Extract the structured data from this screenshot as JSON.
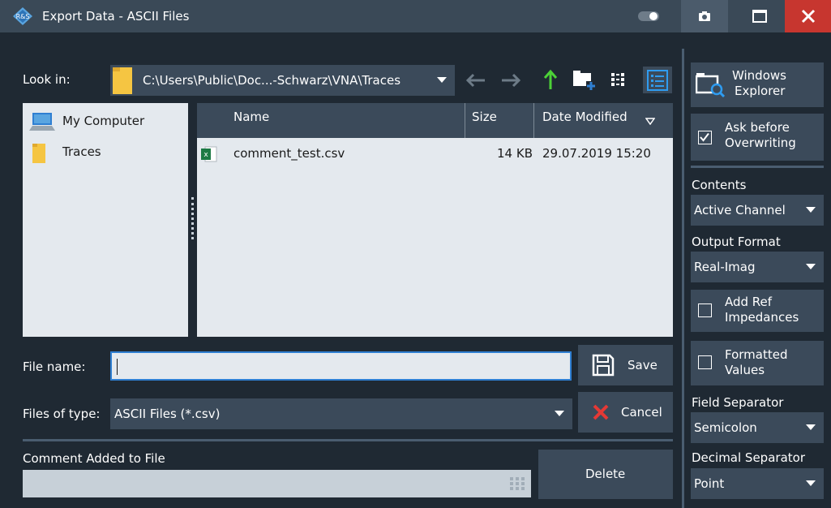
{
  "window": {
    "title": "Export Data - ASCII Files"
  },
  "look_in": {
    "label": "Look in:",
    "path": "C:\\Users\\Public\\Doc...-Schwarz\\VNA\\Traces"
  },
  "toolbar_icons": [
    "back-icon",
    "forward-icon",
    "up-icon",
    "new-folder-icon",
    "list-view-icon",
    "detail-view-icon"
  ],
  "tree": {
    "items": [
      {
        "label": "My Computer",
        "icon": "computer-icon"
      },
      {
        "label": "Traces",
        "icon": "folder-icon"
      }
    ]
  },
  "file_list": {
    "columns": {
      "name": "Name",
      "size": "Size",
      "date": "Date Modified"
    },
    "rows": [
      {
        "name": "comment_test.csv",
        "size": "14 KB",
        "date": "29.07.2019 15:20",
        "icon": "csv-file-icon"
      }
    ]
  },
  "file_name": {
    "label": "File name:",
    "value": ""
  },
  "files_of_type": {
    "label": "Files of type:",
    "value": "ASCII Files (*.csv)"
  },
  "buttons": {
    "save": "Save",
    "cancel": "Cancel",
    "delete": "Delete"
  },
  "comment": {
    "label": "Comment Added to File",
    "value": ""
  },
  "right_panel": {
    "windows_explorer": {
      "line1": "Windows",
      "line2": "Explorer"
    },
    "ask_before": {
      "line1": "Ask before",
      "line2": "Overwriting",
      "checked": true
    },
    "contents_label": "Contents",
    "contents_value": "Active Channel",
    "output_format_label": "Output Format",
    "output_format_value": "Real-Imag",
    "add_ref": {
      "line1": "Add Ref",
      "line2": "Impedances",
      "checked": false
    },
    "formatted": {
      "line1": "Formatted",
      "line2": "Values",
      "checked": false
    },
    "field_sep_label": "Field Separator",
    "field_sep_value": "Semicolon",
    "decimal_sep_label": "Decimal Separator",
    "decimal_sep_value": "Point"
  },
  "colors": {
    "titlebar": "#3a4957",
    "background": "#1f2933",
    "control": "#3b4a5a",
    "list_bg": "#e4e9ee",
    "close": "#c7362f",
    "accent_blue": "#2f7fd2",
    "up_arrow_green": "#4cd137",
    "cancel_red": "#e53935"
  }
}
